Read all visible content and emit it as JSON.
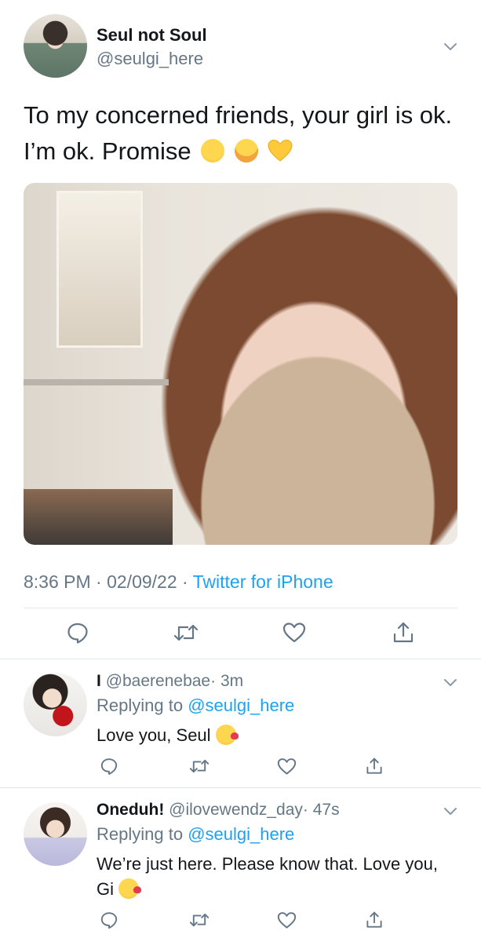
{
  "tweet": {
    "author_name": "Seul not Soul",
    "author_handle": "@seulgi_here",
    "text": "To my concerned friends, your girl is ok. I’m ok. Promise",
    "timestamp": "8:36 PM · 02/09/22 · ",
    "source": "Twitter for iPhone"
  },
  "replies": [
    {
      "author_name": "I",
      "author_handle": "@baerenebae",
      "time": "· 3m",
      "replying_label": "Replying to",
      "replying_to": "@seulgi_here",
      "text": "Love you, Seul"
    },
    {
      "author_name": "Oneduh!",
      "author_handle": "@ilovewendz_day",
      "time": "· 47s",
      "replying_label": "Replying to",
      "replying_to": "@seulgi_here",
      "text": "We’re just here. Please know that. Love you, Gi"
    }
  ],
  "icons": {
    "actions": [
      "reply-icon",
      "retweet-icon",
      "like-icon",
      "share-icon"
    ],
    "more": "chevron-down-icon"
  },
  "colors": {
    "link": "#1da1f2",
    "muted": "#657786",
    "text": "#14171a",
    "divider": "#e1e8ed"
  }
}
